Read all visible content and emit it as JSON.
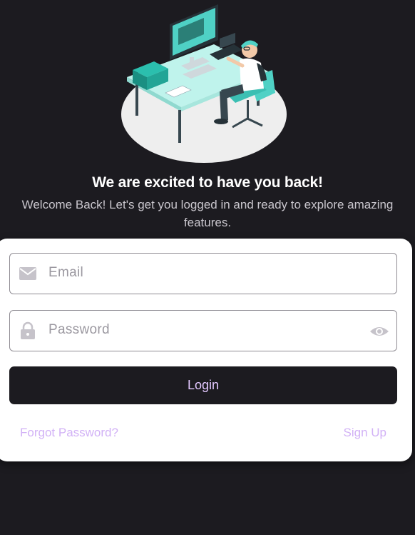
{
  "header": {
    "title": "We are excited to have you back!",
    "subtitle": "Welcome Back! Let's get you logged in and ready to explore amazing features."
  },
  "form": {
    "email": {
      "placeholder": "Email",
      "value": "",
      "icon": "mail-icon"
    },
    "password": {
      "placeholder": "Password",
      "value": "",
      "icon": "lock-icon",
      "toggle_icon": "eye-icon"
    },
    "login_label": "Login",
    "forgot_label": "Forgot Password?",
    "signup_label": "Sign Up"
  },
  "colors": {
    "background": "#1c1b20",
    "card": "#ffffff",
    "accent": "#d2b2f6",
    "illustration_teal": "#4fd1c5"
  }
}
